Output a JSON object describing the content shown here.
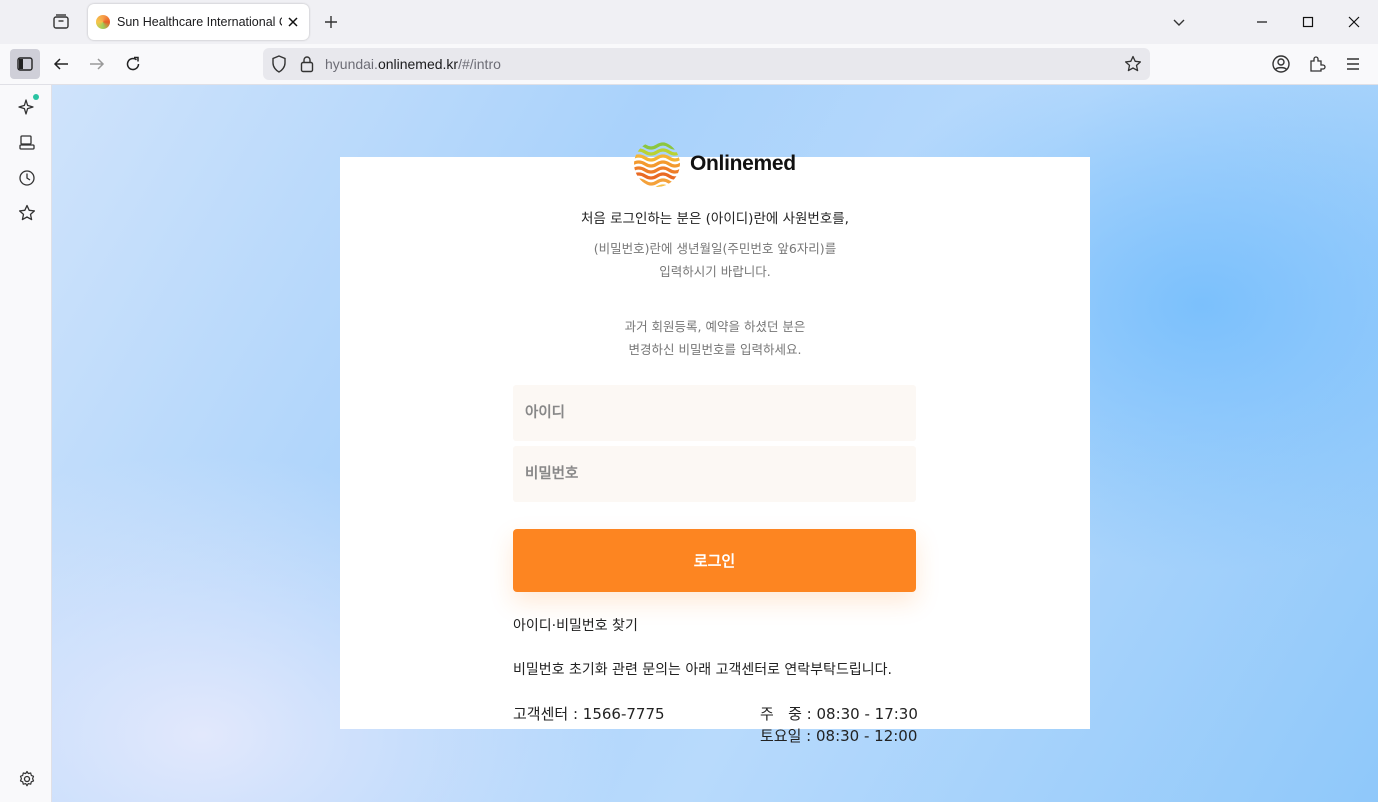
{
  "browser": {
    "tab_title": "Sun Healthcare International C",
    "url_prefix": "hyundai.",
    "url_domain": "onlinemed.kr",
    "url_path": "/#/intro"
  },
  "page": {
    "logo_text": "Onlinemed",
    "instruction_main": "처음 로그인하는 분은 (아이디)란에 사원번호를,",
    "instruction_line2": "(비밀번호)란에 생년월일(주민번호 앞6자리)를",
    "instruction_line3": "입력하시기 바랍니다.",
    "notice_line1": "과거 회원등록, 예약을 하셨던 분은",
    "notice_line2": "변경하신 비밀번호를 입력하세요.",
    "id_placeholder": "아이디",
    "password_placeholder": "비밀번호",
    "login_label": "로그인",
    "find_link": "아이디·비밀번호 찾기",
    "help_text": "비밀번호 초기화 관련 문의는 아래 고객센터로 연락부탁드립니다.",
    "cs_label": "고객센터 : 1566-7775",
    "weekday_hours": "주   중 : 08:30 - 17:30",
    "saturday_hours": "토요일 : 08:30 - 12:00"
  },
  "colors": {
    "accent": "#fd8521",
    "field_bg": "#fcf8f4"
  }
}
